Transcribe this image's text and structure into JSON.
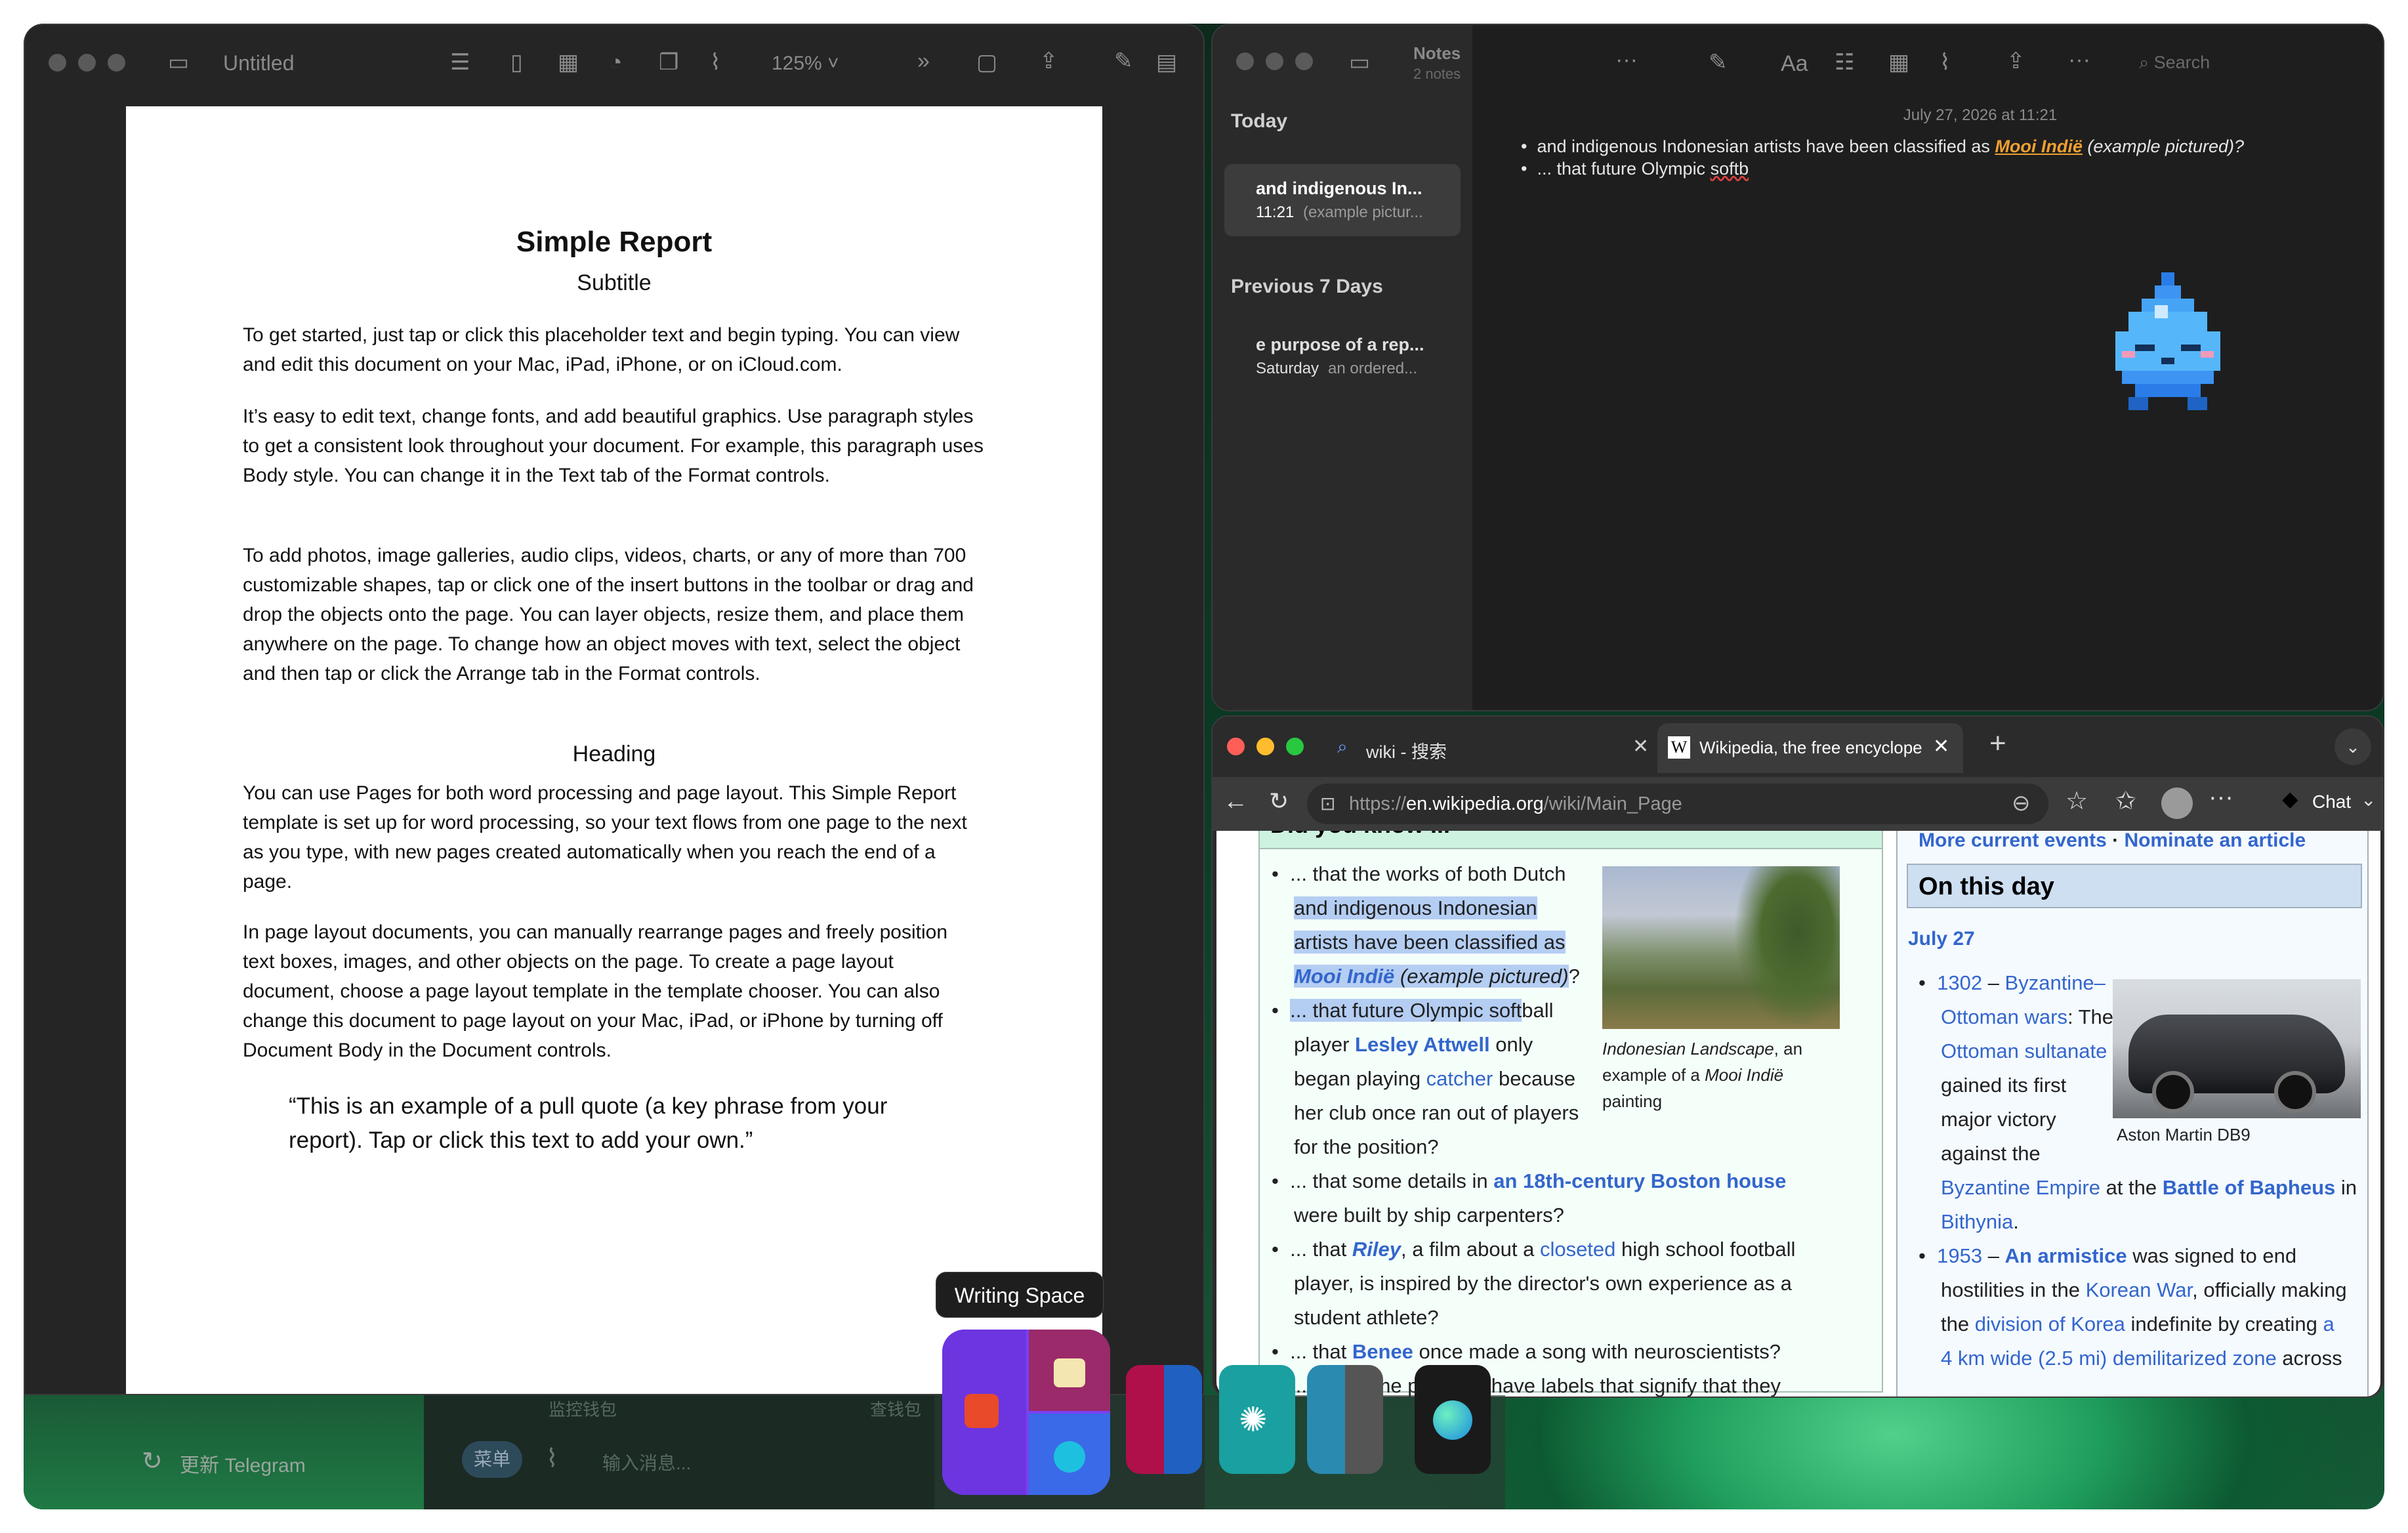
{
  "pages": {
    "title": "Untitled",
    "zoom": "125%",
    "doc": {
      "title": "Simple Report",
      "subtitle": "Subtitle",
      "p1": "To get started, just tap or click this placeholder text and begin typing. You can view and edit this document on your Mac, iPad, iPhone, or on iCloud.com.",
      "p2": "It’s easy to edit text, change fonts, and add beautiful graphics. Use paragraph styles to get a consistent look throughout your document. For example, this paragraph uses Body style. You can change it in the Text tab of the Format controls.",
      "p3": "To add photos, image galleries, audio clips, videos, charts, or any of more than 700 customizable shapes, tap or click one of the insert buttons in the toolbar or drag and drop the objects onto the page. You can layer objects, resize them, and place them anywhere on the page. To change how an object moves with text, select the object and then tap or click the Arrange tab in the Format controls.",
      "heading": "Heading",
      "p4": "You can use Pages for both word processing and page layout. This Simple Report template is set up for word processing, so your text flows from one page to the next as you type, with new pages created automatically when you reach the end of a page.",
      "p5": "In page layout documents, you can manually rearrange pages and freely position text boxes, images, and other objects on the page. To create a page layout document, choose a page layout template in the template chooser. You can also change this document to page layout on your Mac, iPad, or iPhone by turning off Document Body in the Document controls.",
      "quote": "“This is an example of a pull quote (a key phrase from your report). Tap or click this text to add your own.”"
    }
  },
  "notes": {
    "title": "Notes",
    "count": "2 notes",
    "search": "Search",
    "today": "Today",
    "prev7": "Previous 7 Days",
    "note1_title": "and indigenous In...",
    "note1_time": "11:21",
    "note1_preview": "(example pictur...",
    "note2_title": "e purpose of a rep...",
    "note2_time": "Saturday",
    "note2_preview": "an ordered...",
    "date": "July 27, 2026 at 11:21",
    "line1a": "and indigenous Indonesian artists have been classified as ",
    "line1b": "Mooi Indië",
    "line1c": " (example pictured)?",
    "line2a": "... that future Olympic ",
    "line2b": "softb"
  },
  "browser": {
    "tab1": "wiki - 搜索",
    "tab2": "Wikipedia, the free encyclopedia",
    "url_scheme": "https://",
    "url_host": "en.wikipedia.org",
    "url_path": "/wiki/Main_Page",
    "chat": "Chat",
    "dyk_header": "Did you know ...",
    "d1a": "... that the works of both Dutch",
    "d1b": "and indigenous Indonesian",
    "d1c": "artists have been classified as",
    "d1d": "Mooi Indië",
    "d1e": " (example pictured)",
    "d1f": "?",
    "d2a": "... that future Olympic soft",
    "d2b": "ball",
    "d2c": "player ",
    "d2d": "Lesley Attwell",
    "d2e": " only",
    "d2f": "began playing ",
    "d2g": "catcher",
    "d2h": " because",
    "d2i": "her club once ran out of players",
    "d2j": "for the position?",
    "d3a": "... that some details in ",
    "d3b": "an 18th-century Boston house",
    "d3c": "were built by ship carpenters?",
    "d4a": "... that ",
    "d4b": "Riley",
    "d4c": ", a film about a ",
    "d4d": "closeted",
    "d4e": " high school football",
    "d4f": "player, is inspired by the director's own experience as a",
    "d4g": "student athlete?",
    "d5a": "... that ",
    "d5b": "Benee",
    "d5c": " once made a song with neuroscientists?",
    "d6": "... that some products have labels that signify that they",
    "cap1a": "Indonesian Landscape",
    "cap1b": ", an",
    "cap1c": "example of a ",
    "cap1d": "Mooi Indië",
    "cap1e": "painting",
    "more_events": "More current events",
    "sep": " · ",
    "nominate": "Nominate an article",
    "otd_header": "On this day",
    "otd_date": "July 27",
    "e1a": "1302",
    "e1b": " – ",
    "e1c": "Byzantine–",
    "e1d": "Ottoman wars",
    "e1e": ": The",
    "e1f": "Ottoman sultanate",
    "e1g": "gained its first",
    "e1h": "major victory",
    "e1i": "against the",
    "e1j": "Byzantine Empire",
    "e1k": " at the ",
    "e1l": "Battle of Bapheus",
    "e1m": " in",
    "e1n": "Bithynia",
    "e1o": ".",
    "e2a": "1953",
    "e2b": " – ",
    "e2c": "An armistice",
    "e2d": " was signed to end",
    "e2e": "hostilities in the ",
    "e2f": "Korean War",
    "e2g": ", officially making",
    "e2h": "the ",
    "e2i": "division of Korea",
    "e2j": " indefinite by creating ",
    "e2k": "a",
    "e2l": "4 km wide (2.5 mi) demilitarized zone",
    "e2m": " across",
    "cap2": "Aston Martin DB9"
  },
  "telegram": {
    "update": "更新 Telegram",
    "menu": "菜单",
    "input_placeholder": "输入消息...",
    "ghost1": "监控钱包",
    "ghost2": "查钱包"
  },
  "dock": {
    "tooltip": "Writing Space"
  },
  "colors": {
    "accent": "#3366cc",
    "highlight": "#b4cdf2",
    "notes_link": "#f0a030",
    "dock_purple": "#7b3ff2"
  }
}
